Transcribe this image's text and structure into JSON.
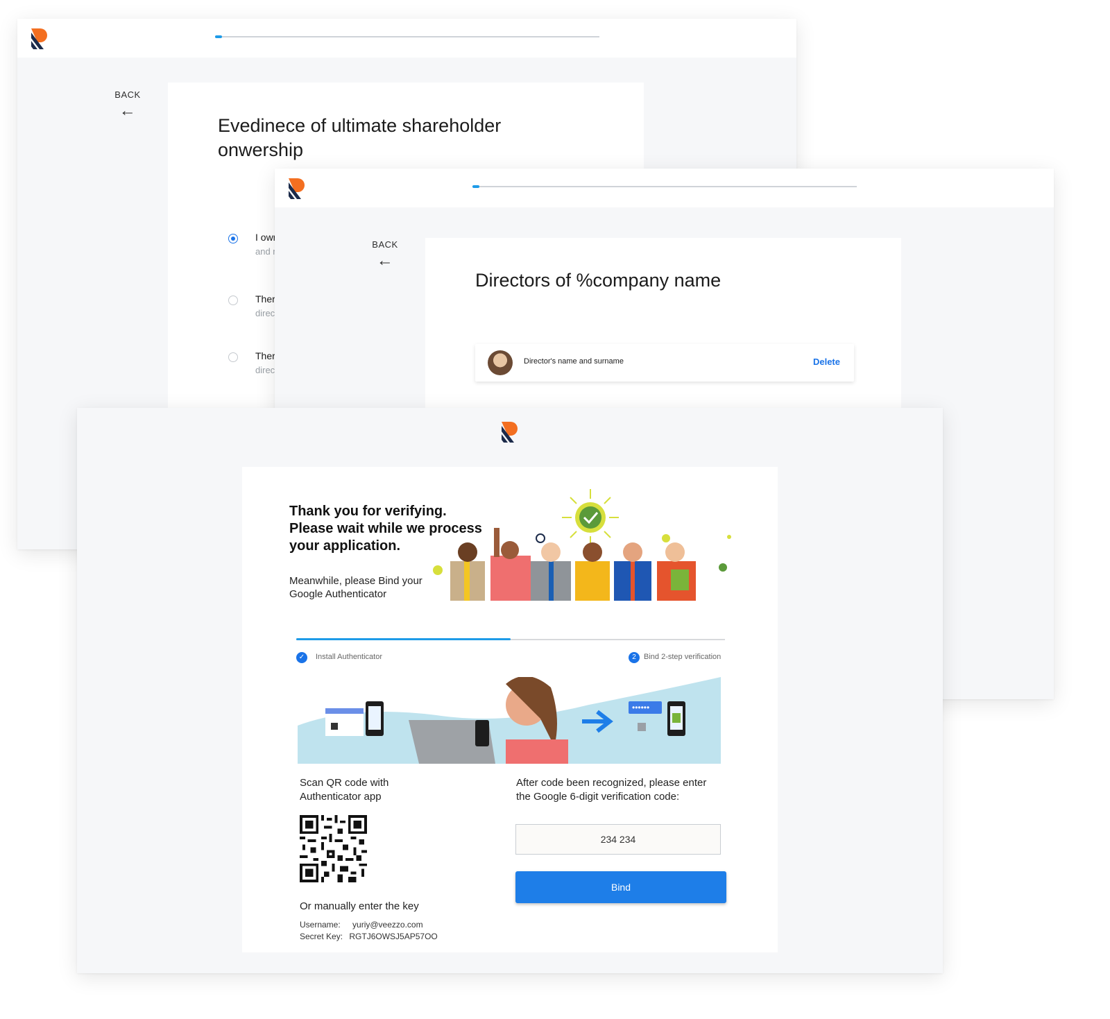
{
  "screen_ownership": {
    "back_label": "BACK",
    "back_arrow": "←",
    "title": "Evedinece of ultimate shareholder onwership",
    "progress": 0.02,
    "options": [
      {
        "title": "I own",
        "subtitle": "and m",
        "selected": true
      },
      {
        "title": "Ther",
        "subtitle": "direc",
        "selected": false
      },
      {
        "title": "Ther",
        "subtitle": "direc",
        "selected": false
      }
    ]
  },
  "screen_directors": {
    "back_label": "BACK",
    "back_arrow": "←",
    "title": "Directors of %company name",
    "progress": 0.02,
    "director": {
      "name": "Director's name and surname",
      "delete_label": "Delete"
    }
  },
  "screen_authenticator": {
    "heading_line1": "Thank you for verifying.",
    "heading_line2": "Please wait while we process",
    "heading_line3": "your application.",
    "sub_line1": "Meanwhile, please Bind your",
    "sub_line2": "Google Authenticator",
    "step_progress": 0.5,
    "steps": [
      {
        "label": "Install Authenticator",
        "icon": "check-icon"
      },
      {
        "label": "Bind 2-step verification",
        "number": "2"
      }
    ],
    "scan_line1": "Scan QR code with",
    "scan_line2": "Authenticator app",
    "manual_key_label": "Or manually enter the key",
    "username_label": "Username:",
    "username_value": "yuriy@veezzo.com",
    "secret_label": "Secret Key:",
    "secret_value": "RGTJ6OWSJ5AP57OO",
    "enter_code_line1": "After code been recognized, please enter",
    "enter_code_line2": "the Google 6-digit verification code:",
    "code_value": "234 234",
    "bind_label": "Bind"
  },
  "colors": {
    "accent": "#1e7ee8",
    "progress": "#1e9be8",
    "logo_orange": "#f36f21",
    "logo_navy": "#1c2b4a",
    "illustration_bg": "#bfe3ee"
  }
}
